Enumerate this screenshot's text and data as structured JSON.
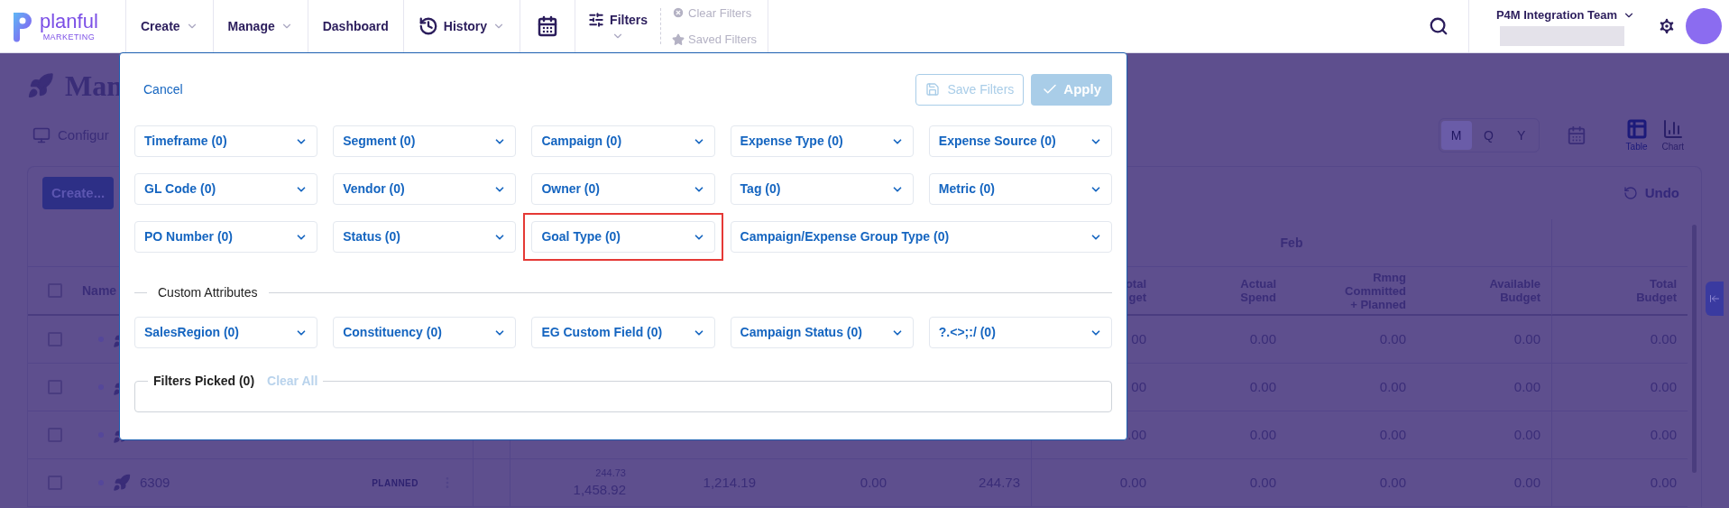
{
  "top_nav": {
    "logo": {
      "name": "planful",
      "tagline": "MARKETING"
    },
    "items": [
      {
        "kind": "dropdown",
        "label": "Create"
      },
      {
        "kind": "dropdown",
        "label": "Manage"
      },
      {
        "kind": "link",
        "label": "Dashboard"
      },
      {
        "kind": "history",
        "label": "History"
      },
      {
        "kind": "calendar"
      },
      {
        "kind": "filters",
        "label": "Filters"
      }
    ],
    "quick_actions": [
      {
        "kind": "clear",
        "label": "Clear Filters",
        "disabled": true
      },
      {
        "kind": "saved",
        "label": "Saved Filters",
        "disabled": true
      }
    ],
    "team": "P4M Integration Team"
  },
  "page": {
    "title": "Man",
    "configure": "Configur",
    "create_button": "Create...",
    "period_toggle": [
      {
        "label": "M",
        "selected": true
      },
      {
        "label": "Q",
        "selected": false
      },
      {
        "label": "Y",
        "selected": false
      }
    ],
    "views": [
      {
        "kind": "table",
        "label": "Table",
        "selected": true
      },
      {
        "kind": "chart",
        "label": "Chart",
        "selected": false
      }
    ],
    "undo": {
      "label": "Undo",
      "disabled": true
    },
    "table": {
      "name_header": "Name",
      "select_all_checked": false,
      "group_header": "Feb",
      "columns": [
        [
          "otal",
          "get"
        ],
        [
          "Actual",
          "Spend"
        ],
        [
          "Rmng",
          "Committed",
          "+ Planned"
        ],
        [
          "Available",
          "Budget"
        ],
        [
          "Total",
          "Budget"
        ]
      ],
      "rows": [
        {
          "checked": false,
          "values": [
            "00",
            "0.00",
            "0.00",
            "0.00",
            "0.00"
          ]
        },
        {
          "checked": false,
          "values": [
            "00",
            "0.00",
            "0.00",
            "0.00",
            "0.00"
          ]
        },
        {
          "checked": false,
          "values": [
            ".00",
            "0.00",
            "0.00",
            "0.00",
            "0.00"
          ]
        },
        {
          "checked": false,
          "name": "6309",
          "status": "PLANNED",
          "mid": [
            {
              "note": "244.73",
              "value": "1,458.92"
            },
            {
              "value": "1,214.19"
            },
            {
              "value": "0.00"
            },
            {
              "value": "244.73"
            }
          ],
          "values": [
            "0.00",
            "0.00",
            "0.00",
            "0.00",
            "0.00"
          ]
        }
      ]
    }
  },
  "dialog": {
    "cancel": "Cancel",
    "save_filters": {
      "label": "Save Filters",
      "disabled": true
    },
    "apply": {
      "label": "Apply",
      "disabled": true
    },
    "filters": [
      {
        "kind": "standard",
        "label": "Timeframe (0)",
        "highlighted": false
      },
      {
        "kind": "standard",
        "label": "Segment (0)",
        "highlighted": false
      },
      {
        "kind": "standard",
        "label": "Campaign (0)",
        "highlighted": false
      },
      {
        "kind": "standard",
        "label": "Expense Type (0)",
        "highlighted": false
      },
      {
        "kind": "standard",
        "label": "Expense Source (0)",
        "highlighted": false
      },
      {
        "kind": "standard",
        "label": "GL Code (0)",
        "highlighted": false
      },
      {
        "kind": "standard",
        "label": "Vendor (0)",
        "highlighted": false
      },
      {
        "kind": "standard",
        "label": "Owner (0)",
        "highlighted": false
      },
      {
        "kind": "standard",
        "label": "Tag (0)",
        "highlighted": false
      },
      {
        "kind": "standard",
        "label": "Metric (0)",
        "highlighted": false
      },
      {
        "kind": "standard",
        "label": "PO Number (0)",
        "highlighted": false
      },
      {
        "kind": "standard",
        "label": "Status (0)",
        "highlighted": false
      },
      {
        "kind": "standard",
        "label": "Goal Type (0)",
        "highlighted": true
      },
      {
        "kind": "wide",
        "label": "Campaign/Expense Group Type (0)",
        "highlighted": false
      }
    ],
    "custom_attributes": {
      "label": "Custom Attributes",
      "filters": [
        {
          "label": "SalesRegion (0)"
        },
        {
          "label": "Constituency (0)"
        },
        {
          "label": "EG Custom Field (0)"
        },
        {
          "label": "Campaign Status (0)"
        },
        {
          "label": "?.<>;:/ (0)"
        }
      ]
    },
    "filters_picked": {
      "label": "Filters Picked (0)",
      "clear_all": {
        "label": "Clear All",
        "disabled": true
      }
    }
  }
}
